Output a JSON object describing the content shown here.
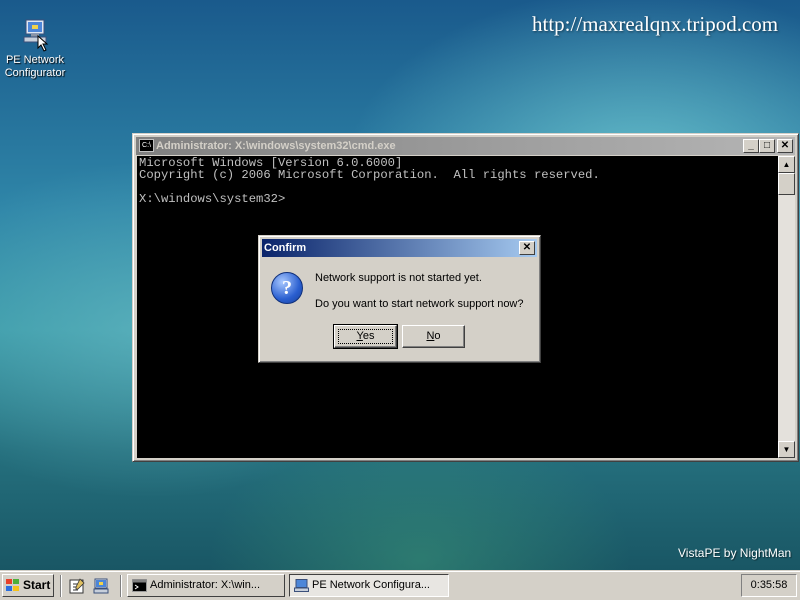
{
  "desktop": {
    "icon_label_line1": "PE Network",
    "icon_label_line2": "Configurator",
    "url_text": "http://maxrealqnx.tripod.com",
    "brand_text": "VistaPE by NightMan"
  },
  "cmd_window": {
    "title": "Administrator: X:\\windows\\system32\\cmd.exe",
    "sys_icon_text": "C:\\",
    "minimize_glyph": "_",
    "maximize_glyph": "□",
    "close_glyph": "✕",
    "lines": [
      "Microsoft Windows [Version 6.0.6000]",
      "Copyright (c) 2006 Microsoft Corporation.  All rights reserved.",
      "",
      "X:\\windows\\system32>"
    ],
    "scroll_up_glyph": "▲",
    "scroll_down_glyph": "▼"
  },
  "dialog": {
    "title": "Confirm",
    "close_glyph": "✕",
    "icon_glyph": "?",
    "message_line1": "Network support is not started yet.",
    "message_line2": "Do you want to start network support now?",
    "yes_mnemonic": "Y",
    "yes_rest": "es",
    "no_mnemonic": "N",
    "no_rest": "o"
  },
  "taskbar": {
    "start_label": "Start",
    "buttons": [
      {
        "label": "Administrator: X:\\win..."
      },
      {
        "label": "PE Network Configura..."
      }
    ],
    "clock": "0:35:58"
  },
  "colors": {
    "titlebar_active": "#0a246a",
    "titlebar_inactive": "#808080",
    "face": "#d4d0c8",
    "console_bg": "#000000",
    "console_fg": "#c0c0c0"
  }
}
